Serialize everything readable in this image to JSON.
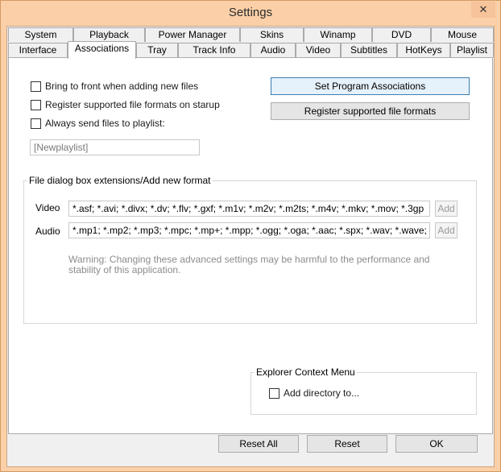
{
  "window": {
    "title": "Settings",
    "close_glyph": "✕"
  },
  "tabs": {
    "row1": [
      "System",
      "Playback",
      "Power Manager",
      "Skins",
      "Winamp",
      "DVD",
      "Mouse"
    ],
    "row2": [
      "Interface",
      "Associations",
      "Tray",
      "Track Info",
      "Audio",
      "Video",
      "Subtitles",
      "HotKeys",
      "Playlist"
    ],
    "active": "Associations"
  },
  "options": {
    "bring_to_front": "Bring to front when adding new files",
    "register_on_startup": "Register supported file formats on starup",
    "always_send": "Always send files to playlist:",
    "playlist_placeholder": "[Newplaylist]"
  },
  "buttons": {
    "set_associations": "Set Program Associations",
    "register_formats": "Register supported file formats",
    "reset_all": "Reset All",
    "reset": "Reset",
    "ok": "OK"
  },
  "extensions": {
    "group_title": "File dialog box extensions/Add new format",
    "video_label": "Video",
    "video_value": "*.asf; *.avi; *.divx; *.dv; *.flv; *.gxf; *.m1v; *.m2v; *.m2ts; *.m4v; *.mkv; *.mov; *.3gp",
    "audio_label": "Audio",
    "audio_value": "*.mp1; *.mp2; *.mp3; *.mpc; *.mp+; *.mpp; *.ogg; *.oga; *.aac; *.spx; *.wav; *.wave; *.",
    "add_label": "Add",
    "warning": "Warning: Changing these advanced settings may be harmful to the performance and stability of this application."
  },
  "context_menu": {
    "group_title": "Explorer Context Menu",
    "add_directory": "Add directory to..."
  }
}
